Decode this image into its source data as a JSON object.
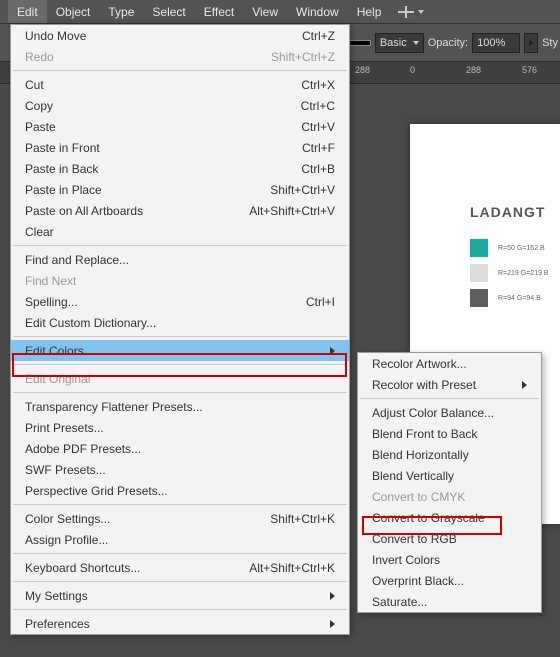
{
  "menubar": {
    "items": [
      "Edit",
      "Object",
      "Type",
      "Select",
      "Effect",
      "View",
      "Window",
      "Help"
    ]
  },
  "toolbar": {
    "basic_label": "Basic",
    "opacity_label": "Opacity:",
    "opacity_value": "100%",
    "style_label": "Sty"
  },
  "ruler": {
    "ticks": [
      "288",
      "0",
      "288",
      "576"
    ]
  },
  "artboard": {
    "title": "LADANGT",
    "colors": [
      {
        "hex": "#19a9a0",
        "label": "R=50  G=162  B"
      },
      {
        "hex": "#dbdbdb",
        "label": "R=219  G=219  B"
      },
      {
        "hex": "#5e5e5e",
        "label": "R=94  G=94  B"
      }
    ]
  },
  "edit_menu": [
    {
      "label": "Undo Move",
      "shortcut": "Ctrl+Z"
    },
    {
      "label": "Redo",
      "shortcut": "Shift+Ctrl+Z",
      "disabled": true
    },
    {
      "sep": true
    },
    {
      "label": "Cut",
      "shortcut": "Ctrl+X"
    },
    {
      "label": "Copy",
      "shortcut": "Ctrl+C"
    },
    {
      "label": "Paste",
      "shortcut": "Ctrl+V"
    },
    {
      "label": "Paste in Front",
      "shortcut": "Ctrl+F"
    },
    {
      "label": "Paste in Back",
      "shortcut": "Ctrl+B"
    },
    {
      "label": "Paste in Place",
      "shortcut": "Shift+Ctrl+V"
    },
    {
      "label": "Paste on All Artboards",
      "shortcut": "Alt+Shift+Ctrl+V"
    },
    {
      "label": "Clear"
    },
    {
      "sep": true
    },
    {
      "label": "Find and Replace..."
    },
    {
      "label": "Find Next",
      "disabled": true
    },
    {
      "label": "Spelling...",
      "shortcut": "Ctrl+I"
    },
    {
      "label": "Edit Custom Dictionary..."
    },
    {
      "sep": true
    },
    {
      "label": "Edit Colors",
      "submenu": true,
      "highlight": true
    },
    {
      "sep": true
    },
    {
      "label": "Edit Original",
      "disabled": true
    },
    {
      "sep": true
    },
    {
      "label": "Transparency Flattener Presets..."
    },
    {
      "label": "Print Presets..."
    },
    {
      "label": "Adobe PDF Presets..."
    },
    {
      "label": "SWF Presets..."
    },
    {
      "label": "Perspective Grid Presets..."
    },
    {
      "sep": true
    },
    {
      "label": "Color Settings...",
      "shortcut": "Shift+Ctrl+K"
    },
    {
      "label": "Assign Profile..."
    },
    {
      "sep": true
    },
    {
      "label": "Keyboard Shortcuts...",
      "shortcut": "Alt+Shift+Ctrl+K"
    },
    {
      "sep": true
    },
    {
      "label": "My Settings",
      "submenu": true
    },
    {
      "sep": true
    },
    {
      "label": "Preferences",
      "submenu": true
    }
  ],
  "edit_colors_submenu": [
    {
      "label": "Recolor Artwork..."
    },
    {
      "label": "Recolor with Preset",
      "submenu": true
    },
    {
      "sep": true
    },
    {
      "label": "Adjust Color Balance..."
    },
    {
      "label": "Blend Front to Back"
    },
    {
      "label": "Blend Horizontally"
    },
    {
      "label": "Blend Vertically"
    },
    {
      "label": "Convert to CMYK",
      "disabled": true
    },
    {
      "label": "Convert to Grayscale"
    },
    {
      "label": "Convert to RGB"
    },
    {
      "label": "Invert Colors"
    },
    {
      "label": "Overprint Black..."
    },
    {
      "label": "Saturate..."
    }
  ]
}
